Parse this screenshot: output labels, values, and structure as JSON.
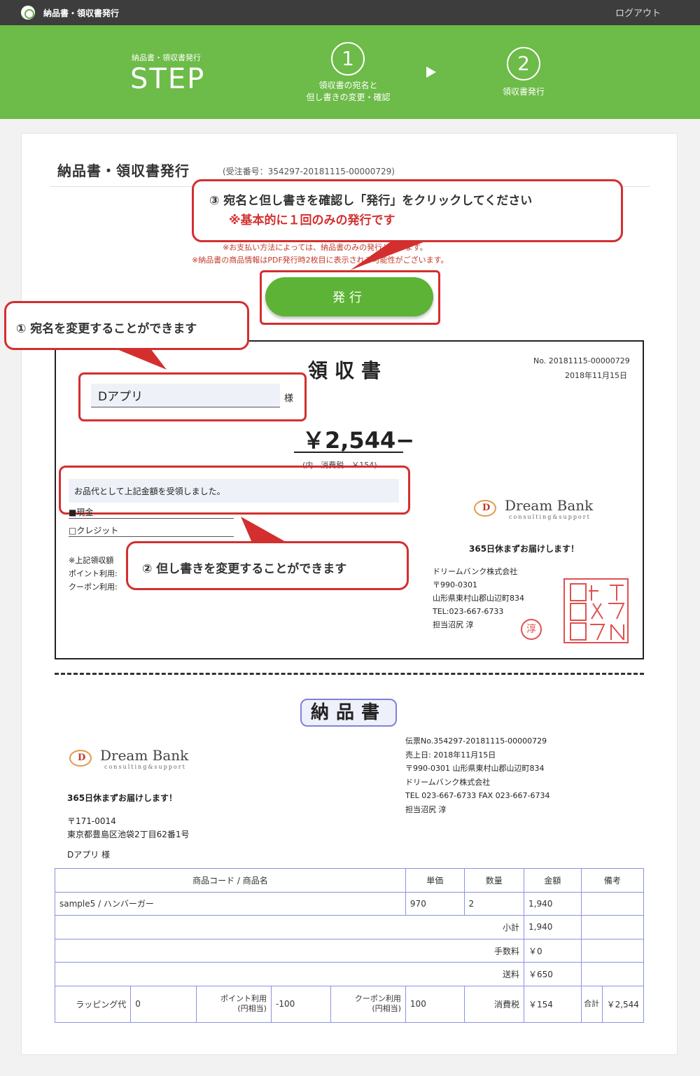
{
  "topbar": {
    "app_title": "納品書・領収書発行",
    "logout": "ログアウト"
  },
  "steps": {
    "small_label": "納品書・領収書発行",
    "big_label": "STEP",
    "step1": {
      "number": "1",
      "line1": "領収書の宛名と",
      "line2": "但し書きの変更・確認"
    },
    "step2": {
      "number": "2",
      "label": "領収書発行"
    }
  },
  "page": {
    "title": "納品書・領収書発行",
    "order_no": "(受注番号：354297-20181115-00000729)",
    "note1": "※お支払い方法によっては、納品書のみの発行となります。",
    "note2": "※納品書の商品情報はPDF発行時2枚目に表示される可能性がございます。",
    "issue_button": "発行"
  },
  "callouts": {
    "c3_line1": "③ 宛名と但し書きを確認し「発行」をクリックしてください",
    "c3_line2": "※基本的に１回のみの発行です",
    "c1": "① 宛名を変更することができます",
    "c2": "② 但し書きを変更することができます"
  },
  "receipt": {
    "title": "領収書",
    "no": "No. 20181115-00000729",
    "date": "2018年11月15日",
    "addressee": "Dアプリ",
    "honorific": "様",
    "amount": "￥2,544−",
    "tax": "(内　消費税　￥154)",
    "proviso": "お品代として上記金額を受領しました。",
    "pay_cash": "■現金",
    "pay_credit": "□クレジット",
    "note_l1": "※上記領収額",
    "note_l2": "ポイント利用:",
    "note_l3": "クーポン利用:",
    "slogan": "365日休まずお届けします！",
    "company": "ドリームバンク株式会社",
    "zip": "〒990-0301",
    "address": "山形県東村山郡山辺町834",
    "tel": "TEL:023-667-6733",
    "staff": "担当沼尻 淳",
    "round_seal": "淳",
    "square_seal": "ドリーム バンク 株式会社 代表取締役印"
  },
  "logo": {
    "name": "Dream Bank",
    "sub": "consulting&support",
    "mark": "D"
  },
  "delivery": {
    "title": "納品書",
    "slip_no": "伝票No.354297-20181115-00000729",
    "sale_date": "売上日: 2018年11月15日",
    "company_addr": "〒990-0301 山形県東村山郡山辺町834",
    "company": "ドリームバンク株式会社",
    "tel_fax": "TEL 023-667-6733 FAX 023-667-6734",
    "staff": "担当沼尻 淳",
    "slogan": "365日休まずお届けします！",
    "cust_zip": "〒171-0014",
    "cust_addr": "東京都豊島区池袋2丁目62番1号",
    "cust_name": "Dアプリ 様"
  },
  "table": {
    "headers": [
      "商品コード / 商品名",
      "単価",
      "数量",
      "金額",
      "備考"
    ],
    "row": {
      "name": "sample5 / ハンバーガー",
      "price": "970",
      "qty": "2",
      "amount": "1,940"
    },
    "subtotal": {
      "label": "小計",
      "value": "1,940"
    },
    "fee": {
      "label": "手数料",
      "value": "￥0"
    },
    "shipping": {
      "label": "送料",
      "value": "￥650"
    },
    "footer": {
      "wrap_label": "ラッピング代",
      "wrap_value": "0",
      "point_label": "ポイント利用",
      "point_sub": "(円相当)",
      "point_value": "-100",
      "coupon_label": "クーポン利用",
      "coupon_sub": "(円相当)",
      "coupon_value": "100",
      "tax_label": "消費税",
      "tax_value": "￥154",
      "total_label": "合計",
      "total_value": "￥2,544"
    }
  }
}
